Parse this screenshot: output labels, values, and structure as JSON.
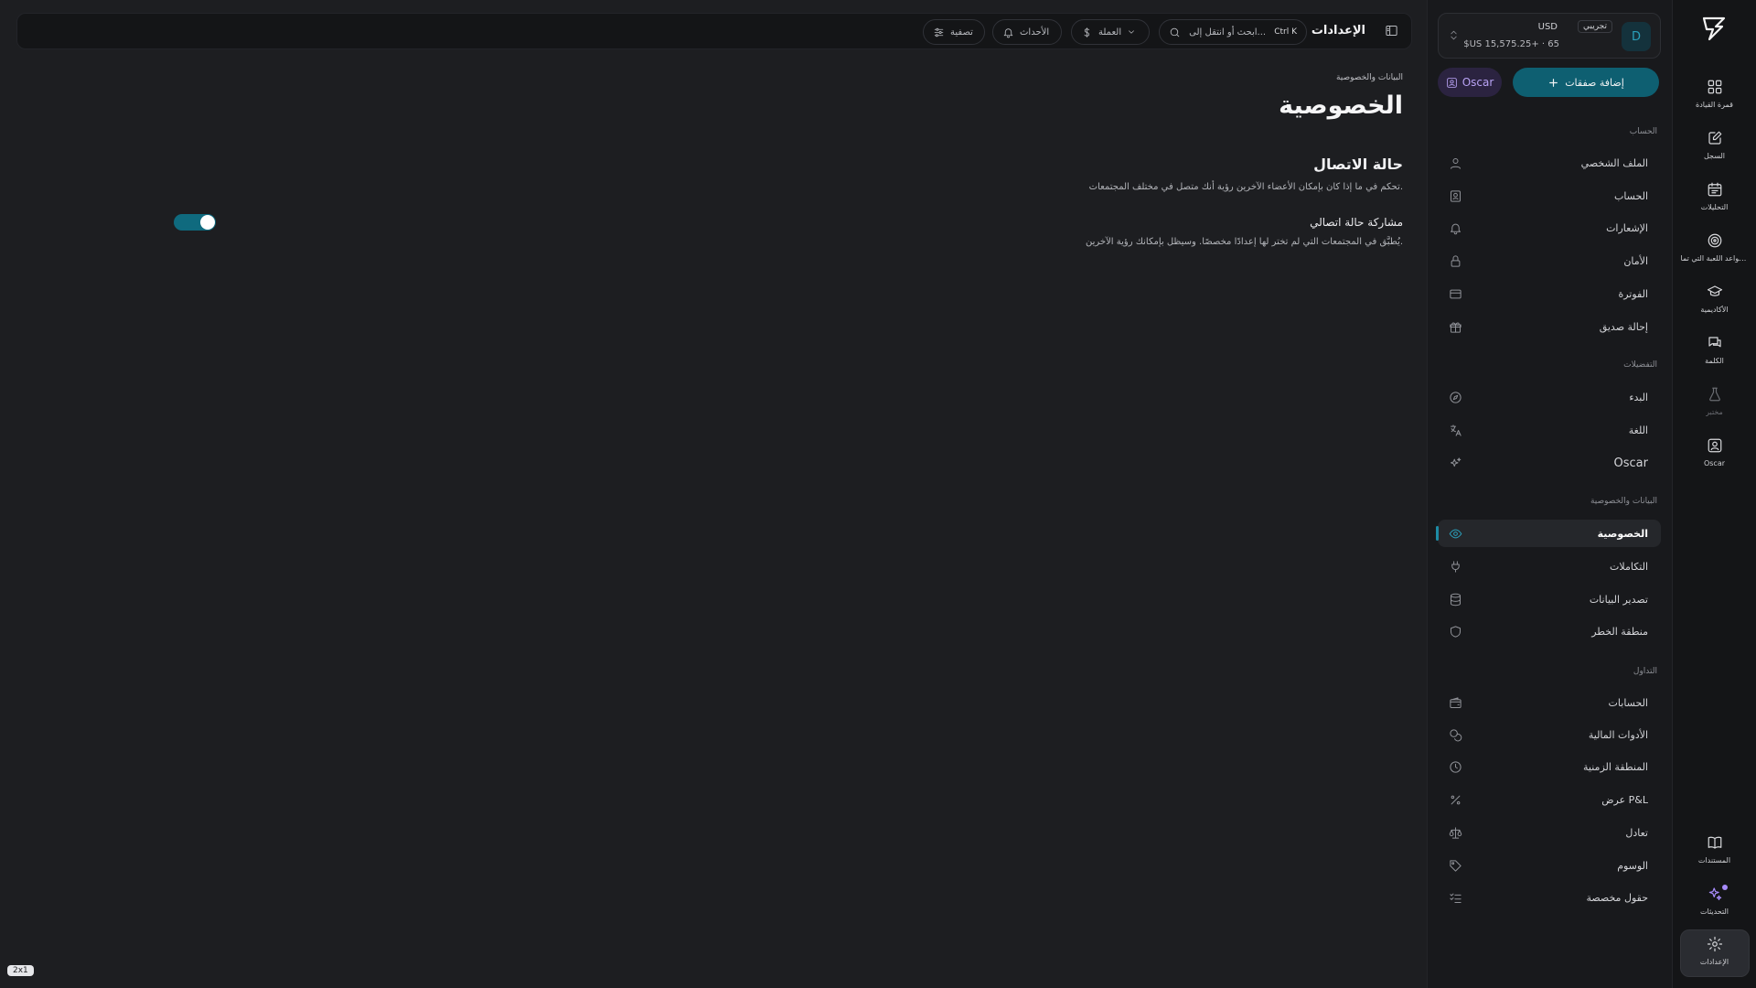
{
  "rail": {
    "items": [
      {
        "label": "قمرة القيادة",
        "icon": "dashboard-grid-icon"
      },
      {
        "label": "السجل",
        "icon": "journal-edit-icon"
      },
      {
        "label": "التحليلات",
        "icon": "calendar-analytics-icon"
      },
      {
        "label": "قواعد اللعبة التي تما...",
        "icon": "target-icon"
      },
      {
        "label": "الأكاديمية",
        "icon": "graduation-cap-icon"
      },
      {
        "label": "الكلمة",
        "icon": "chat-icon"
      },
      {
        "label": "مختبر",
        "icon": "flask-icon"
      },
      {
        "label": "Oscar",
        "icon": "oscar-icon"
      }
    ],
    "bottom_items": [
      {
        "label": "المستندات",
        "icon": "book-icon"
      },
      {
        "label": "التحديثات",
        "icon": "sparkles-icon"
      },
      {
        "label": "الإعدادات",
        "icon": "gear-icon"
      }
    ]
  },
  "account": {
    "avatar": "D",
    "badge": "تجريبي",
    "currency": "USD",
    "balance": "$US 15,575.25+ · 65"
  },
  "actions": {
    "add_trades": "إضافة صفقات",
    "oscar": "Oscar"
  },
  "sidebar": {
    "sections": [
      {
        "title": "الحساب",
        "items": [
          {
            "label": "الملف الشخصي",
            "icon": "user-icon"
          },
          {
            "label": "الحساب",
            "icon": "account-icon"
          },
          {
            "label": "الإشعارات",
            "icon": "bell-icon"
          },
          {
            "label": "الأمان",
            "icon": "lock-icon"
          },
          {
            "label": "الفوترة",
            "icon": "credit-card-icon"
          },
          {
            "label": "إحالة صديق",
            "icon": "gift-icon"
          }
        ]
      },
      {
        "title": "التفضيلات",
        "items": [
          {
            "label": "البدء",
            "icon": "compass-icon"
          },
          {
            "label": "اللغة",
            "icon": "translate-icon"
          },
          {
            "label": "Oscar",
            "icon": "sparkle-icon"
          }
        ]
      },
      {
        "title": "البيانات والخصوصية",
        "items": [
          {
            "label": "الخصوصية",
            "icon": "eye-icon",
            "active": true
          },
          {
            "label": "التكاملات",
            "icon": "plug-icon"
          },
          {
            "label": "تصدير البيانات",
            "icon": "database-icon"
          },
          {
            "label": "منطقة الخطر",
            "icon": "shield-icon"
          }
        ]
      },
      {
        "title": "التداول",
        "items": [
          {
            "label": "الحسابات",
            "icon": "wallet-icon"
          },
          {
            "label": "الأدوات المالية",
            "icon": "coins-icon"
          },
          {
            "label": "المنطقة الزمنية",
            "icon": "clock-icon"
          },
          {
            "label": "عرض P&L",
            "icon": "percent-icon"
          },
          {
            "label": "تعادل",
            "icon": "scale-icon"
          },
          {
            "label": "الوسوم",
            "icon": "tag-icon"
          },
          {
            "label": "حقول مخصصة",
            "icon": "list-check-icon"
          }
        ]
      }
    ]
  },
  "topbar": {
    "title": "الإعدادات",
    "search_placeholder": "ابحث أو انتقل إلى...",
    "search_shortcut": "Ctrl K",
    "currency": "العملة",
    "events": "الأحداث",
    "filter": "تصفية"
  },
  "content": {
    "breadcrumb": "البيانات والخصوصية",
    "title": "الخصوصية",
    "section_title": "حالة الاتصال",
    "section_desc": "تحكم في ما إذا كان بإمكان الأعضاء الآخرين رؤية أنك متصل في مختلف المجتمعات.",
    "option_title": "مشاركة حالة اتصالي",
    "option_desc": "يُطبَّق في المجتمعات التي لم تختر لها إعدادًا مخصصًا. وسيظل بإمكانك رؤية الآخرين.",
    "toggle_on": true
  },
  "zoom_badge": "2x1",
  "colors": {
    "accent": "#0e5f71",
    "accent_text": "#2aa0bb",
    "oscar_purple": "#b9a3f5",
    "background": "#1d1e21"
  }
}
